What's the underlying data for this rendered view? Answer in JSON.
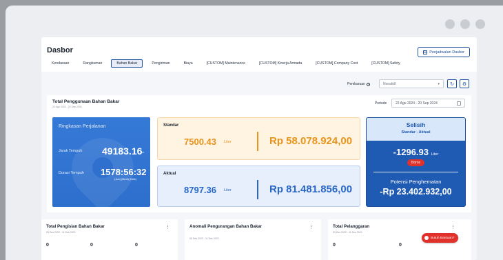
{
  "header": {
    "title": "Dasbor",
    "schedule_button": "Penjadwalan Dasbor"
  },
  "tabs": [
    {
      "label": "Kendaraan",
      "active": false
    },
    {
      "label": "Rangkuman",
      "active": false
    },
    {
      "label": "Bahan Bakar",
      "active": true
    },
    {
      "label": "Pengiriman",
      "active": false
    },
    {
      "label": "Biaya",
      "active": false
    },
    {
      "label": "[CUSTOM] Maintenance",
      "active": false
    },
    {
      "label": "[CUSTOM] Kinerja Armada",
      "active": false
    },
    {
      "label": "[CUSTOM] Company Cost",
      "active": false
    },
    {
      "label": "[CUSTOM] Safety",
      "active": false
    }
  ],
  "filters": {
    "refresh_label": "Pembaruan",
    "refresh_value": "Nonaktif"
  },
  "fuel_usage": {
    "title": "Total Penggunaan Bahan Bakar",
    "subtitle": "22 Agu 2024 - 20 Sep 2024",
    "period_label": "Periode",
    "period_value": "22 Agu 2024 - 20 Sep 2024",
    "trip": {
      "title": "Ringkasan Perjalanan",
      "distance_label": "Jarak Tempuh",
      "distance_value": "49183.16",
      "distance_unit": "Km",
      "duration_label": "Durasi Tempuh",
      "duration_value": "1578:56:32",
      "duration_unit": "(Jam) (Menit) (Detik)"
    },
    "standard": {
      "label": "Standar",
      "volume": "7500.43",
      "unit": "Liter",
      "cost": "Rp 58.078.924,00"
    },
    "actual": {
      "label": "Aktual",
      "volume": "8797.36",
      "unit": "Liter",
      "cost": "Rp 81.481.856,00"
    },
    "difference": {
      "title": "Selisih",
      "subtitle": "Standar - Aktual",
      "value": "-1296.93",
      "unit": "Liter",
      "badge": "Boros",
      "savings_label": "Potensi Penghematan",
      "savings_value": "-Rp 23.402.932,00"
    }
  },
  "cards": [
    {
      "title": "Total Pengisian Bahan Bakar",
      "date": "05 Des 2023 - 11 Des 2023",
      "values": [
        "0",
        "0",
        "0"
      ]
    },
    {
      "title": "Anomali Pengurangan Bahan Bakar",
      "date": "05 Des 2023 - 11 Des 2023",
      "values": []
    },
    {
      "title": "Total Pelanggaran",
      "date": "05 Des 2023 - 11 Des 2023",
      "values": [
        "0",
        "0"
      ]
    }
  ],
  "help_button": "Butuh Bantuan?"
}
